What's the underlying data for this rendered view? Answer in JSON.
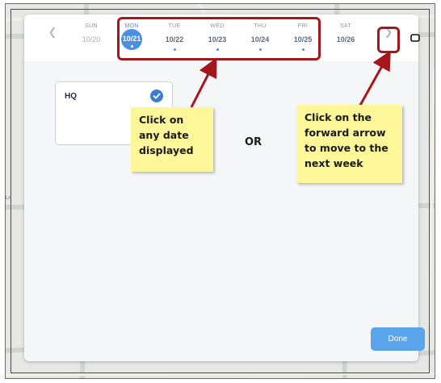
{
  "calendar": {
    "days": [
      {
        "dow": "SUN",
        "date": "10/20",
        "state": "past",
        "dot": false
      },
      {
        "dow": "MON",
        "date": "10/21",
        "state": "selected",
        "dot": true
      },
      {
        "dow": "TUE",
        "date": "10/22",
        "state": "normal",
        "dot": true
      },
      {
        "dow": "WED",
        "date": "10/23",
        "state": "normal",
        "dot": true
      },
      {
        "dow": "THU",
        "date": "10/24",
        "state": "normal",
        "dot": true
      },
      {
        "dow": "FRI",
        "date": "10/25",
        "state": "normal",
        "dot": true
      },
      {
        "dow": "SAT",
        "date": "10/26",
        "state": "normal",
        "dot": false
      }
    ],
    "prev_icon": "chevron-left-icon",
    "next_icon": "chevron-right-icon"
  },
  "location_card": {
    "name": "HQ",
    "checked": true
  },
  "callouts": {
    "left": "Click on any date displayed",
    "or": "OR",
    "right": "Click on the forward arrow to move to the next week"
  },
  "done_label": "Done",
  "colors": {
    "accent": "#4a90e2",
    "highlight": "#a3171d",
    "callout_bg": "#fdf79a",
    "done_bg": "#5aa4ec"
  }
}
